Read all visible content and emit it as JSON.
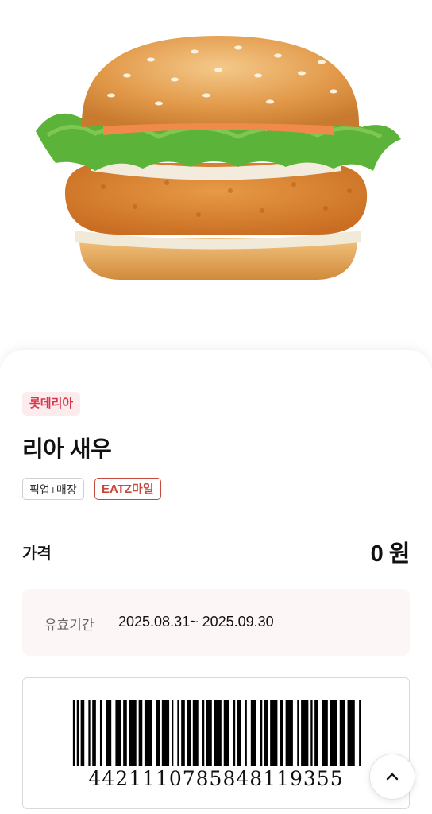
{
  "product": {
    "brand": "롯데리아",
    "name": "리아 새우",
    "tags": [
      "픽업+매장",
      "EATZ마일"
    ],
    "image_icon": "shrimp-burger-image"
  },
  "price": {
    "label": "가격",
    "value": "0 원"
  },
  "validity": {
    "label": "유효기간",
    "value": "2025.08.31~ 2025.09.30"
  },
  "barcode": {
    "number": "4421110785848119355"
  },
  "colors": {
    "brand_chip_bg": "#fdecee",
    "brand_chip_text": "#d8344a",
    "eatz_tag": "#c9483c",
    "validity_bg": "#fdf6f7"
  },
  "icons": {
    "scroll_top": "chevron-up-icon"
  }
}
